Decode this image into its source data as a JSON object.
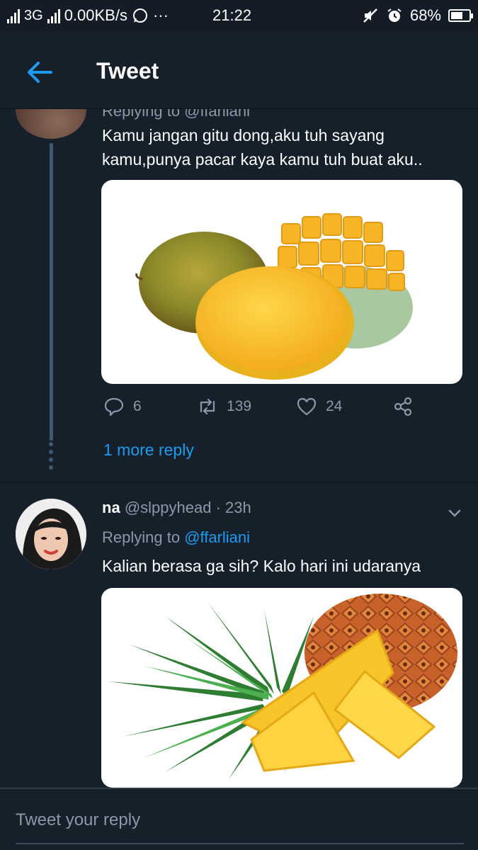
{
  "status_bar": {
    "network": "3G",
    "speed": "0.00KB/s",
    "more": "···",
    "time": "21:22",
    "battery": "68%",
    "battery_level": 0.68
  },
  "header": {
    "title": "Tweet"
  },
  "thread": {
    "parent_tweet": {
      "replying_cut": "Replying to @ffarliani",
      "text": "Kamu jangan gitu dong,aku tuh sayang kamu,punya pacar kaya kamu tuh buat aku..",
      "image_icon": "mango-image",
      "replies": "6",
      "retweets": "139",
      "likes": "24"
    },
    "more_replies": "1 more reply",
    "reply_tweet": {
      "name": "na",
      "handle": "@slppyhead",
      "time_sep": " · ",
      "time": "23h",
      "replying_label": "Replying to ",
      "replying_handle": "@ffarliani",
      "text": "Kalian berasa ga sih? Kalo hari ini udaranya",
      "image_icon": "pineapple-image"
    }
  },
  "composer": {
    "placeholder": "Tweet your reply"
  },
  "colors": {
    "background": "#15202b",
    "accent": "#1d9bf0",
    "muted": "#8b98a5",
    "thread_line": "#3d5a73"
  }
}
